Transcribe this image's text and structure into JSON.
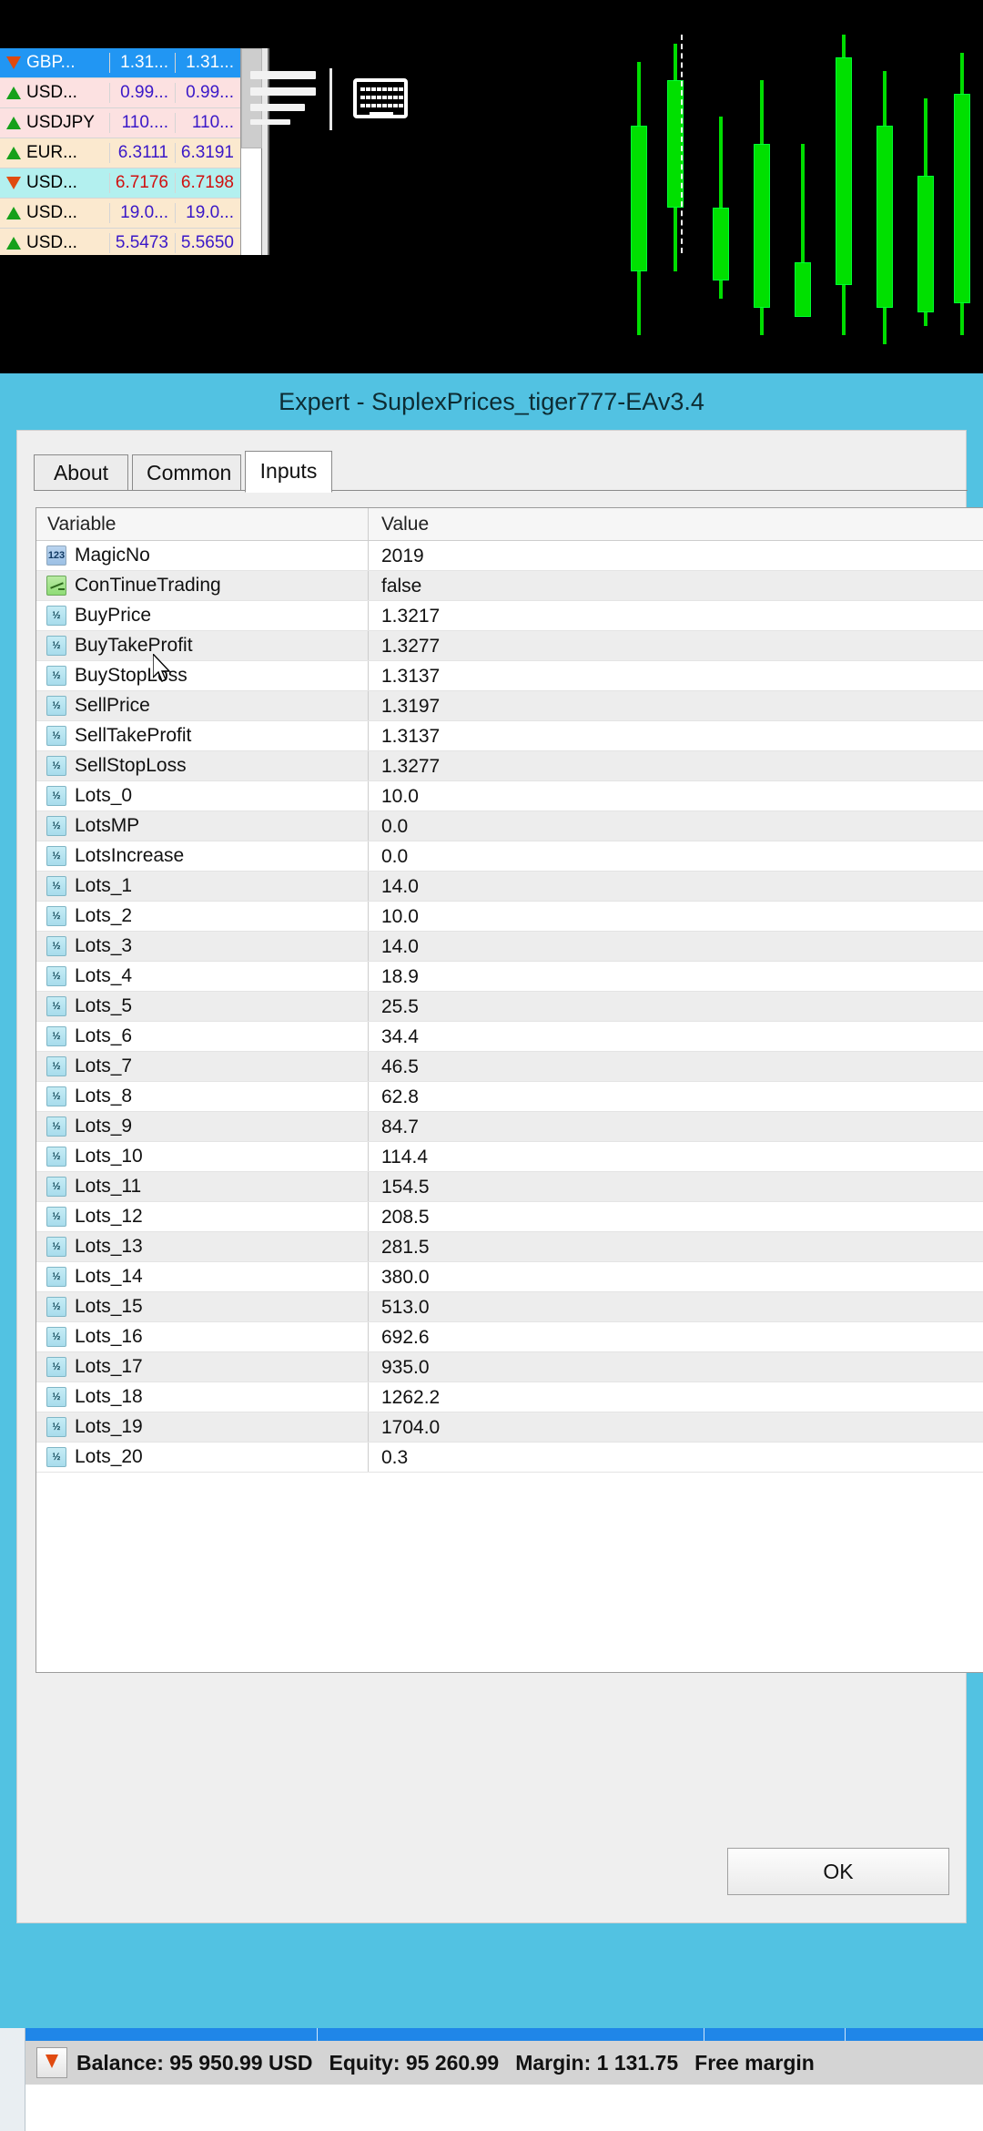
{
  "market_watch": {
    "rows": [
      {
        "symbol": "GBP...",
        "bid": "1.31...",
        "ask": "1.31...",
        "dir": "down",
        "style": "sel"
      },
      {
        "symbol": "USD...",
        "bid": "0.99...",
        "ask": "0.99...",
        "dir": "up",
        "style": "pink"
      },
      {
        "symbol": "USDJPY",
        "bid": "110....",
        "ask": "110...",
        "dir": "up",
        "style": "pink"
      },
      {
        "symbol": "EUR...",
        "bid": "6.3111",
        "ask": "6.3191",
        "dir": "up",
        "style": "cream"
      },
      {
        "symbol": "USD...",
        "bid": "6.7176",
        "ask": "6.7198",
        "dir": "down",
        "style": "cyan"
      },
      {
        "symbol": "USD...",
        "bid": "19.0...",
        "ask": "19.0...",
        "dir": "up",
        "style": "cream"
      },
      {
        "symbol": "USD...",
        "bid": "5.5473",
        "ask": "5.5650",
        "dir": "up",
        "style": "cream"
      }
    ]
  },
  "dialog": {
    "title": "Expert - SuplexPrices_tiger777-EAv3.4",
    "tabs": [
      {
        "label": "About",
        "active": false
      },
      {
        "label": "Common",
        "active": false
      },
      {
        "label": "Inputs",
        "active": true
      }
    ],
    "grid": {
      "headers": {
        "variable": "Variable",
        "value": "Value"
      },
      "rows": [
        {
          "icon": "int",
          "variable": "MagicNo",
          "value": "2019"
        },
        {
          "icon": "bool",
          "variable": "ConTinueTrading",
          "value": "false"
        },
        {
          "icon": "dbl",
          "variable": "BuyPrice",
          "value": "1.3217"
        },
        {
          "icon": "dbl",
          "variable": "BuyTakeProfit",
          "value": "1.3277"
        },
        {
          "icon": "dbl",
          "variable": "BuyStopLoss",
          "value": "1.3137"
        },
        {
          "icon": "dbl",
          "variable": "SellPrice",
          "value": "1.3197"
        },
        {
          "icon": "dbl",
          "variable": "SellTakeProfit",
          "value": "1.3137"
        },
        {
          "icon": "dbl",
          "variable": "SellStopLoss",
          "value": "1.3277"
        },
        {
          "icon": "dbl",
          "variable": "Lots_0",
          "value": "10.0"
        },
        {
          "icon": "dbl",
          "variable": "LotsMP",
          "value": "0.0"
        },
        {
          "icon": "dbl",
          "variable": "LotsIncrease",
          "value": "0.0"
        },
        {
          "icon": "dbl",
          "variable": "Lots_1",
          "value": "14.0"
        },
        {
          "icon": "dbl",
          "variable": "Lots_2",
          "value": "10.0"
        },
        {
          "icon": "dbl",
          "variable": "Lots_3",
          "value": "14.0"
        },
        {
          "icon": "dbl",
          "variable": "Lots_4",
          "value": "18.9"
        },
        {
          "icon": "dbl",
          "variable": "Lots_5",
          "value": "25.5"
        },
        {
          "icon": "dbl",
          "variable": "Lots_6",
          "value": "34.4"
        },
        {
          "icon": "dbl",
          "variable": "Lots_7",
          "value": "46.5"
        },
        {
          "icon": "dbl",
          "variable": "Lots_8",
          "value": "62.8"
        },
        {
          "icon": "dbl",
          "variable": "Lots_9",
          "value": "84.7"
        },
        {
          "icon": "dbl",
          "variable": "Lots_10",
          "value": "114.4"
        },
        {
          "icon": "dbl",
          "variable": "Lots_11",
          "value": "154.5"
        },
        {
          "icon": "dbl",
          "variable": "Lots_12",
          "value": "208.5"
        },
        {
          "icon": "dbl",
          "variable": "Lots_13",
          "value": "281.5"
        },
        {
          "icon": "dbl",
          "variable": "Lots_14",
          "value": "380.0"
        },
        {
          "icon": "dbl",
          "variable": "Lots_15",
          "value": "513.0"
        },
        {
          "icon": "dbl",
          "variable": "Lots_16",
          "value": "692.6"
        },
        {
          "icon": "dbl",
          "variable": "Lots_17",
          "value": "935.0"
        },
        {
          "icon": "dbl",
          "variable": "Lots_18",
          "value": "1262.2"
        },
        {
          "icon": "dbl",
          "variable": "Lots_19",
          "value": "1704.0"
        },
        {
          "icon": "dbl",
          "variable": "Lots_20",
          "value": "0.3"
        }
      ]
    },
    "ok_label": "OK"
  },
  "status_bar": {
    "balance": "Balance: 95 950.99 USD",
    "equity": "Equity: 95 260.99",
    "margin": "Margin: 1 131.75",
    "free_margin": "Free margin"
  }
}
